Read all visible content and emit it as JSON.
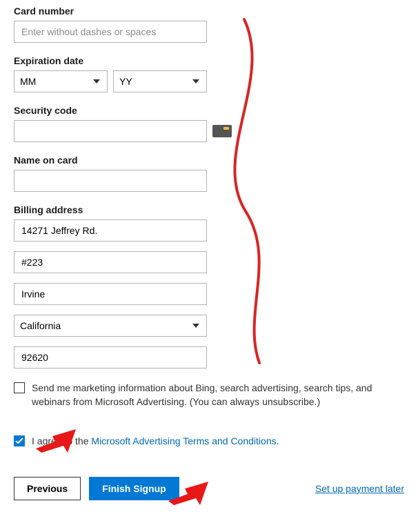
{
  "card_number": {
    "label": "Card number",
    "placeholder": "Enter without dashes or spaces",
    "value": ""
  },
  "expiration": {
    "label": "Expiration date",
    "month": "MM",
    "year": "YY"
  },
  "security": {
    "label": "Security code",
    "value": ""
  },
  "name_on_card": {
    "label": "Name on card",
    "value": ""
  },
  "billing": {
    "label": "Billing address",
    "line1": "14271 Jeffrey Rd.",
    "line2": "#223",
    "city": "Irvine",
    "state": "California",
    "zip": "92620"
  },
  "marketing_checkbox": {
    "checked": false,
    "text": "Send me marketing information about Bing, search advertising, search tips, and webinars from Microsoft Advertising. (You can always unsubscribe.)"
  },
  "agree_checkbox": {
    "checked": true,
    "text_prefix": "I agree to the ",
    "link_text": "Microsoft Advertising Terms and Conditions",
    "text_suffix": "."
  },
  "buttons": {
    "previous": "Previous",
    "finish": "Finish Signup",
    "pay_later": "Set up payment later"
  }
}
